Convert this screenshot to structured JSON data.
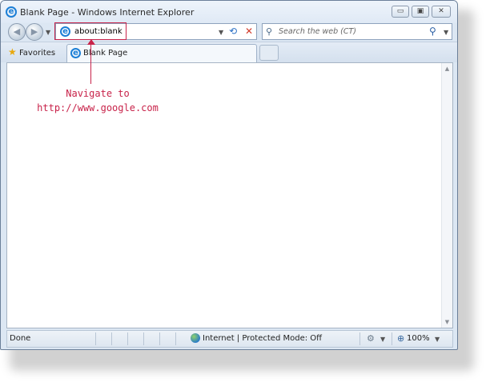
{
  "window": {
    "title": "Blank Page - Windows Internet Explorer",
    "controls": {
      "minimize_icon": "minimize-icon",
      "restore_icon": "restore-icon",
      "close_icon": "close-icon"
    }
  },
  "navbar": {
    "back_icon": "back-arrow-icon",
    "forward_icon": "forward-arrow-icon",
    "address_value": "about:blank",
    "search_placeholder": "Search the web (CT)"
  },
  "favorites_bar": {
    "favorites_label": "Favorites",
    "tab_label": "Blank Page"
  },
  "status_bar": {
    "status_text": "Done",
    "zone_text": "Internet | Protected Mode: Off",
    "zoom": "100%"
  },
  "annotation": {
    "line1": "Navigate to",
    "line2": "http://www.google.com"
  },
  "colors": {
    "accent": "#1c7fd6",
    "annotation": "#c8234a",
    "frame": "#dce7f3"
  }
}
